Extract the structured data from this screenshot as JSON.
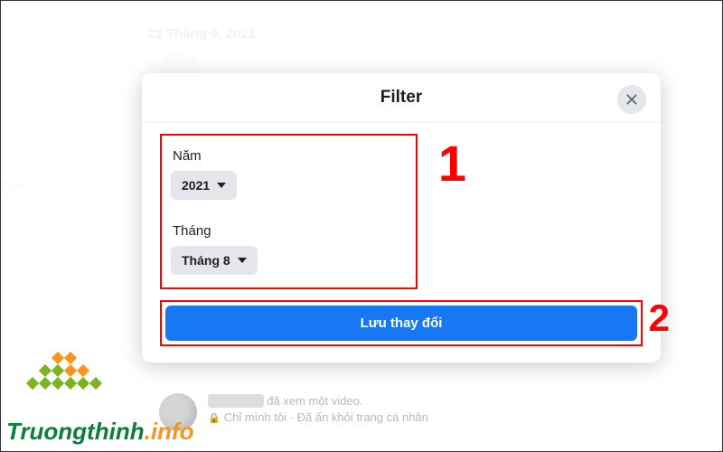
{
  "background": {
    "date_header": "22 Tháng 9, 2021",
    "side_text": "h và",
    "feed_line1_suffix": " đã xem một video.",
    "feed_line2": "Chỉ mình tôi · Đã ẩn khỏi trang cá nhân"
  },
  "modal": {
    "title": "Filter",
    "year_label": "Năm",
    "year_value": "2021",
    "month_label": "Tháng",
    "month_value": "Tháng 8",
    "save_label": "Lưu thay đổi"
  },
  "callouts": {
    "one": "1",
    "two": "2"
  },
  "watermark": {
    "brand": "Truongthinh",
    "suffix": ".info"
  }
}
